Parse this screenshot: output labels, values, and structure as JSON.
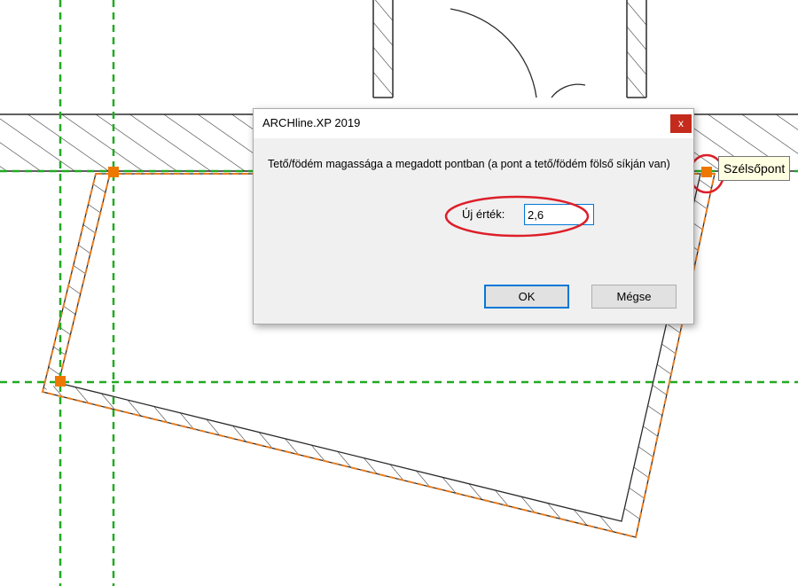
{
  "dialog": {
    "title": "ARCHline.XP 2019",
    "close_label": "x",
    "message": "Tető/födém magassága a megadott pontban (a pont a tető/födém fölső síkján van)",
    "new_value_label": "Új érték:",
    "new_value": "2,6",
    "ok_label": "OK",
    "cancel_label": "Mégse"
  },
  "tooltip": {
    "text": "Szélsőpont"
  },
  "colors": {
    "guide_line": "#22aa22",
    "selection_outline": "#e87c1e",
    "grip_point": "#ee7700",
    "highlight_circle": "#dd1f2a",
    "hatch": "#2a2a2a",
    "accent": "#0078d7",
    "close_button": "#c42b1c"
  }
}
